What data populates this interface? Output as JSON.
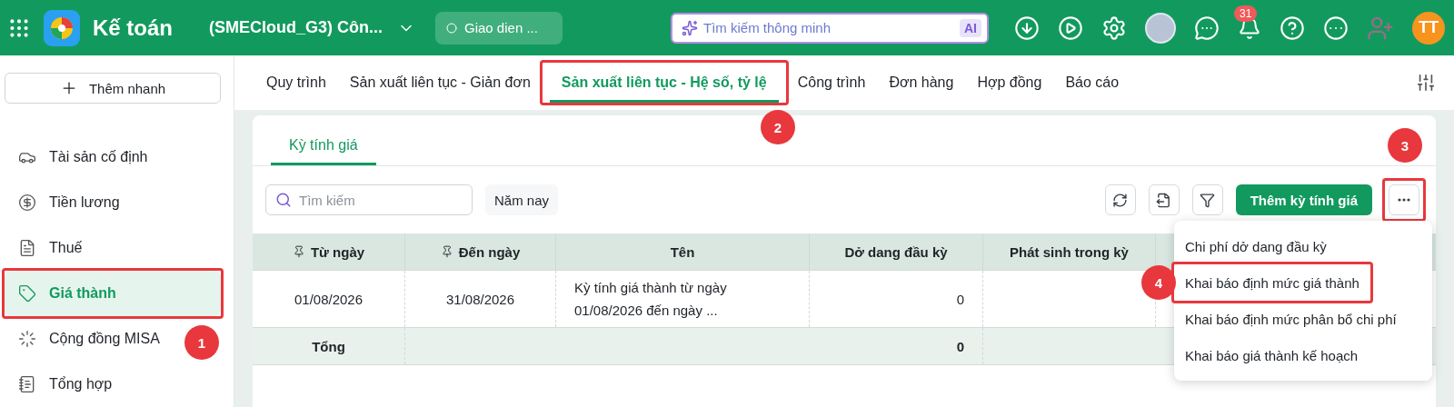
{
  "header": {
    "app_title": "Kế toán",
    "company": "(SMECloud_G3) Côn...",
    "theme_pill": "Giao dien ...",
    "search": {
      "placeholder": "Tìm kiếm thông minh",
      "badge": "AI"
    },
    "notification_count": "31",
    "user_initials": "TT"
  },
  "sidebar": {
    "quick_add": "Thêm nhanh",
    "items": [
      {
        "label": "Tài sản cố định",
        "selected": false,
        "highlighted": false
      },
      {
        "label": "Tiền lương",
        "selected": false,
        "highlighted": false
      },
      {
        "label": "Thuế",
        "selected": false,
        "highlighted": false
      },
      {
        "label": "Giá thành",
        "selected": true,
        "highlighted": true,
        "callout": "1"
      },
      {
        "label": "Cộng đồng MISA",
        "selected": false,
        "highlighted": false
      },
      {
        "label": "Tổng hợp",
        "selected": false,
        "highlighted": false
      }
    ]
  },
  "tabs": [
    {
      "label": "Quy trình",
      "selected": false,
      "highlighted": false
    },
    {
      "label": "Sản xuất liên tục - Giản đơn",
      "selected": false,
      "highlighted": false
    },
    {
      "label": "Sản xuất liên tục - Hệ số, tỷ lệ",
      "selected": true,
      "highlighted": true,
      "callout": "2"
    },
    {
      "label": "Công trình",
      "selected": false,
      "highlighted": false
    },
    {
      "label": "Đơn hàng",
      "selected": false,
      "highlighted": false
    },
    {
      "label": "Hợp đồng",
      "selected": false,
      "highlighted": false
    },
    {
      "label": "Báo cáo",
      "selected": false,
      "highlighted": false
    }
  ],
  "card": {
    "tabs": [
      {
        "label": "Kỳ tính giá",
        "selected": true
      }
    ],
    "search": {
      "placeholder": "Tìm kiếm"
    },
    "period_filter": "Năm nay",
    "add_button": "Thêm kỳ tính giá",
    "more_button": {
      "highlighted": true,
      "callout": "3"
    },
    "table": {
      "columns": [
        {
          "label": "Từ ngày",
          "pinned": true
        },
        {
          "label": "Đến ngày",
          "pinned": true
        },
        {
          "label": "Tên",
          "pinned": false
        },
        {
          "label": "Dở dang đầu kỳ",
          "pinned": false
        },
        {
          "label": "Phát sinh trong kỳ",
          "pinned": false
        }
      ],
      "rows": [
        {
          "cells": [
            "01/08/2026",
            "31/08/2026",
            "Kỳ tính giá thành từ ngày 01/08/2026 đến ngày ...",
            "0"
          ]
        }
      ],
      "total_row": {
        "label": "Tổng",
        "opening_wip": "0"
      }
    },
    "menu": {
      "items": [
        {
          "label": "Chi phí dở dang đầu kỳ",
          "highlighted": false
        },
        {
          "label": "Khai báo định mức giá thành",
          "highlighted": true,
          "callout": "4"
        },
        {
          "label": "Khai báo định mức phân bổ chi phí",
          "highlighted": false
        },
        {
          "label": "Khai báo giá thành kế hoạch",
          "highlighted": false
        }
      ]
    }
  }
}
